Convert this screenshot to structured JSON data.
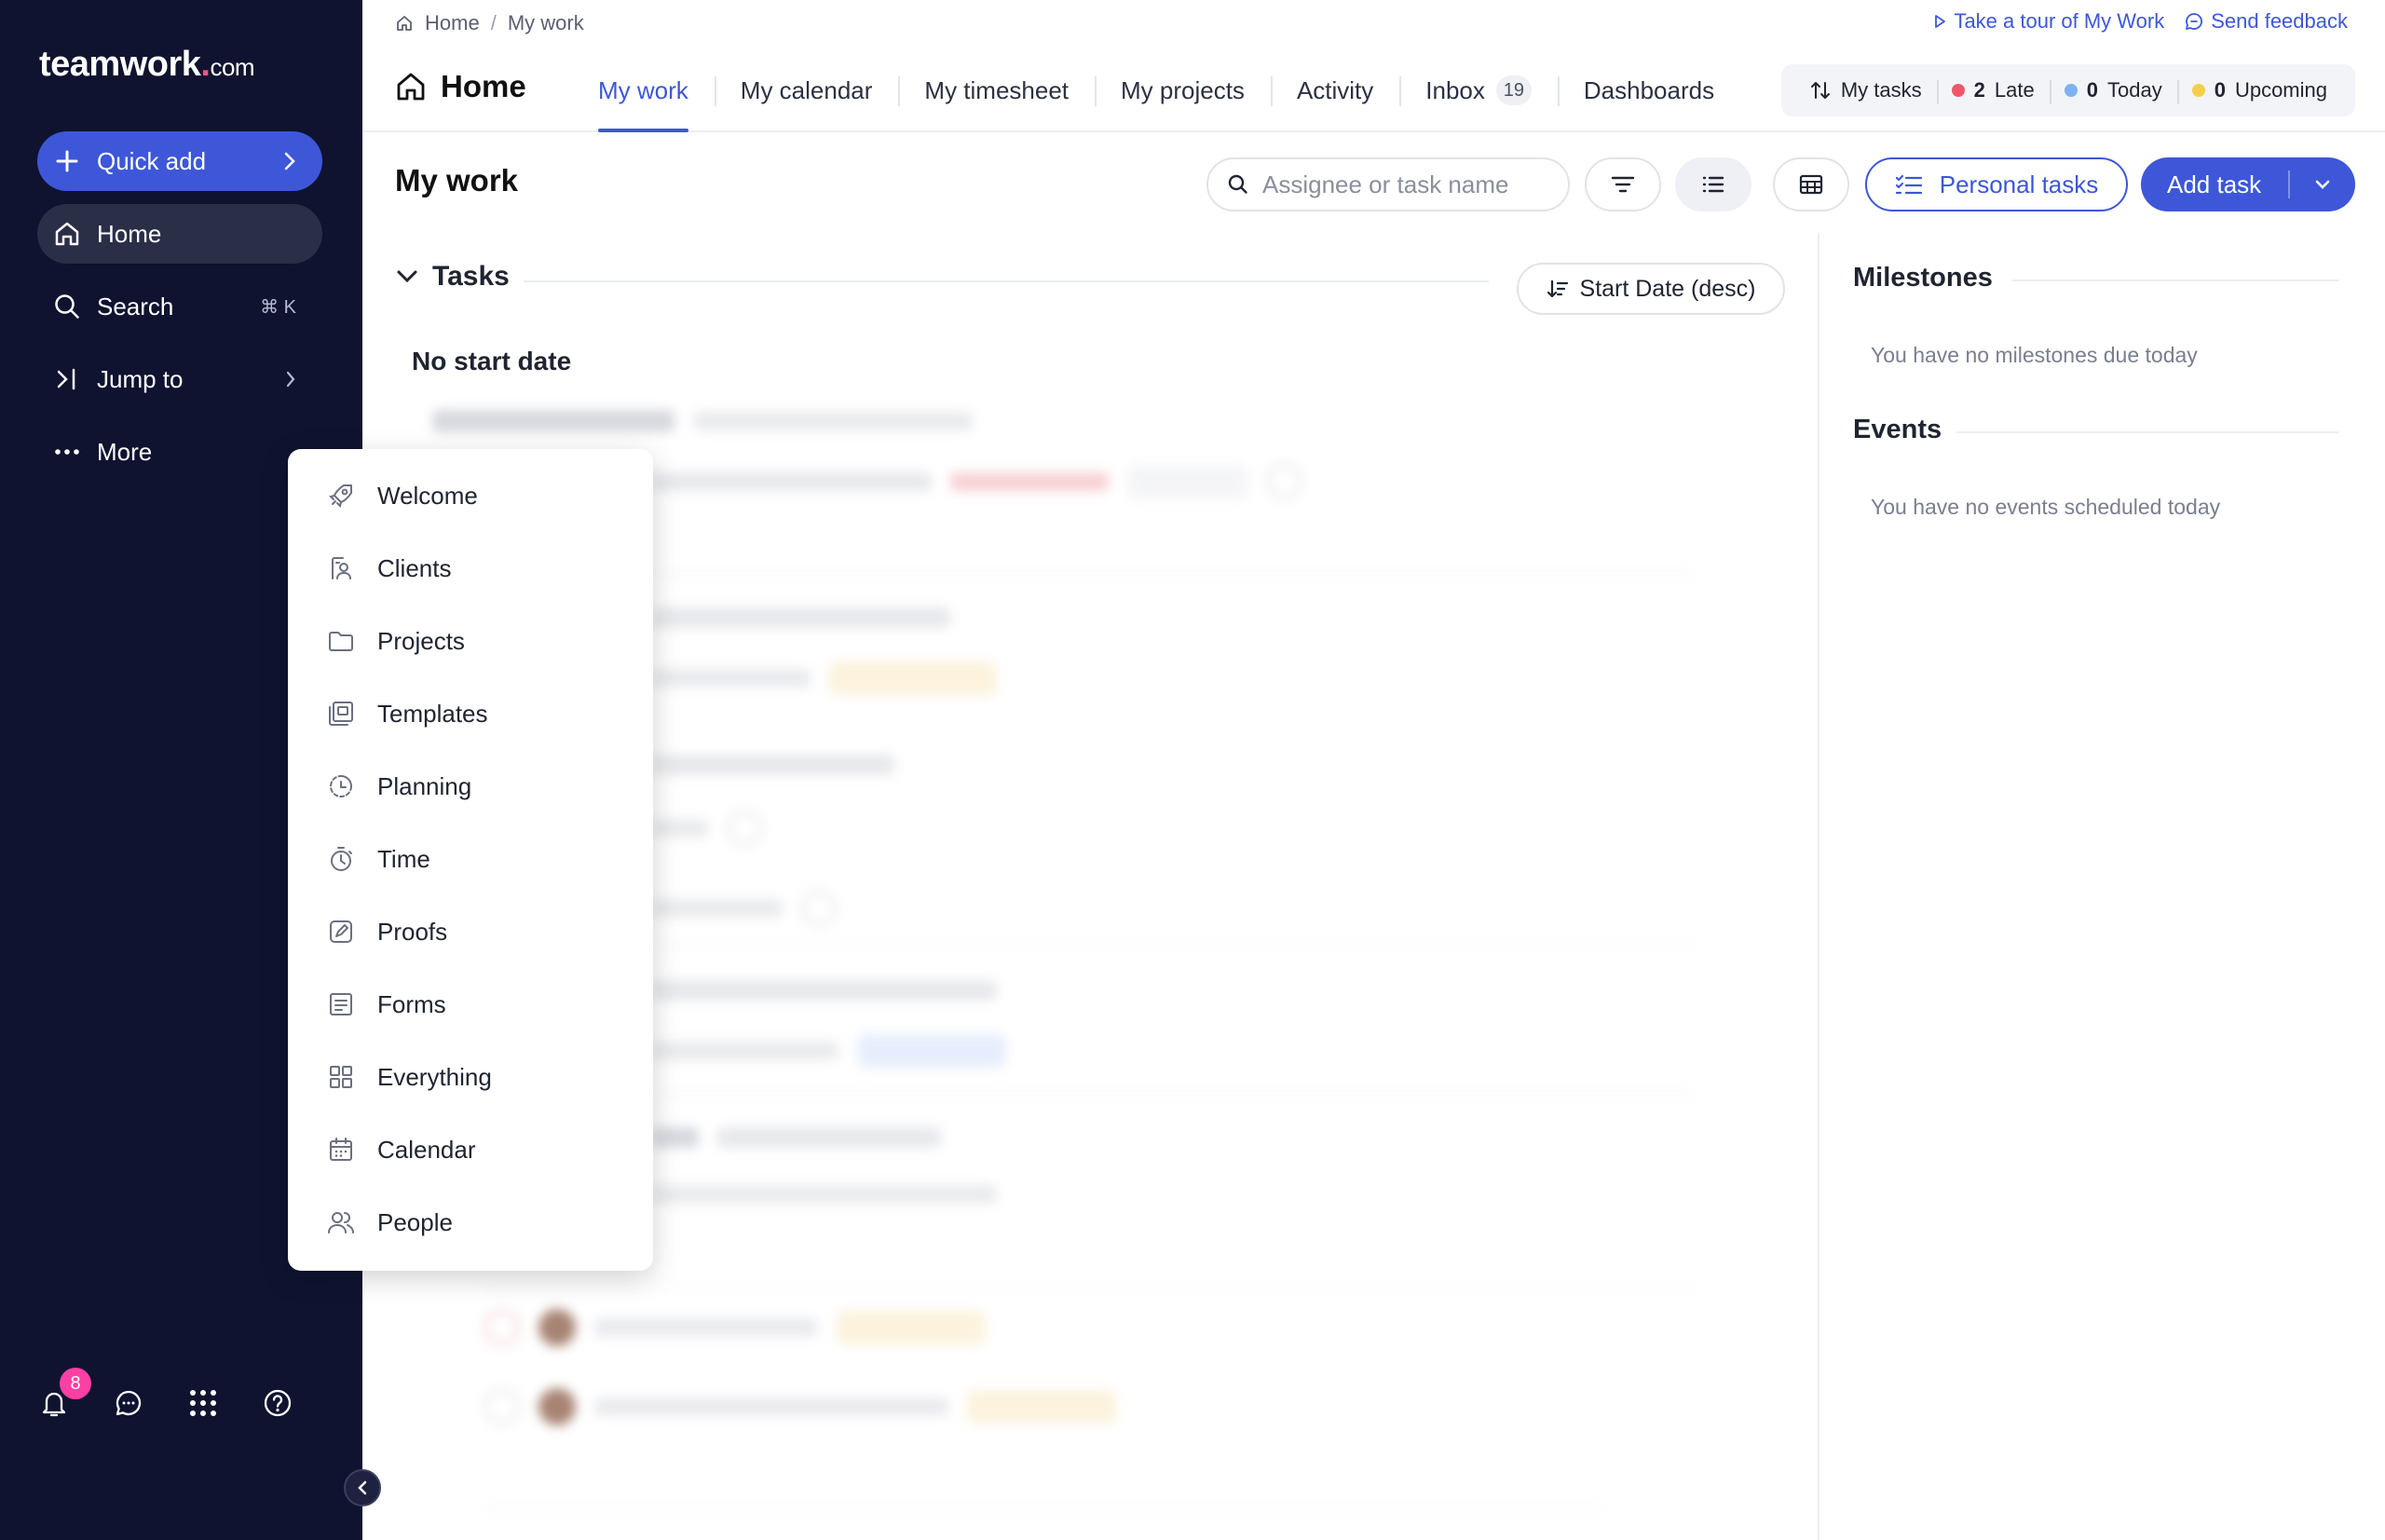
{
  "brand": {
    "logo_text": "teamwork",
    "logo_dot": ".",
    "logo_suffix": "com",
    "accent": "#3d57d8",
    "sidebar_bg": "#0f1330"
  },
  "sidebar": {
    "quick_add": "Quick add",
    "home": "Home",
    "search": "Search",
    "search_shortcut": "⌘ K",
    "jump_to": "Jump to",
    "more": "More",
    "notifications_count": "8"
  },
  "more_menu": {
    "items": [
      {
        "label": "Welcome",
        "icon": "rocket-icon"
      },
      {
        "label": "Clients",
        "icon": "clients-icon"
      },
      {
        "label": "Projects",
        "icon": "folder-icon"
      },
      {
        "label": "Templates",
        "icon": "templates-icon"
      },
      {
        "label": "Planning",
        "icon": "planning-icon"
      },
      {
        "label": "Time",
        "icon": "stopwatch-icon"
      },
      {
        "label": "Proofs",
        "icon": "proofs-icon"
      },
      {
        "label": "Forms",
        "icon": "forms-icon"
      },
      {
        "label": "Everything",
        "icon": "grid-icon"
      },
      {
        "label": "Calendar",
        "icon": "calendar-icon"
      },
      {
        "label": "People",
        "icon": "people-icon"
      }
    ]
  },
  "breadcrumb": {
    "home": "Home",
    "separator": "/",
    "current": "My work"
  },
  "top_links": {
    "tour": "Take a tour of My Work",
    "feedback": "Send feedback"
  },
  "nav": {
    "title": "Home",
    "tabs": [
      {
        "label": "My work",
        "active": true
      },
      {
        "label": "My calendar"
      },
      {
        "label": "My timesheet"
      },
      {
        "label": "My projects"
      },
      {
        "label": "Activity"
      },
      {
        "label": "Inbox",
        "count": "19"
      },
      {
        "label": "Dashboards"
      }
    ]
  },
  "summary": {
    "my_tasks": "My tasks",
    "late_count": "2",
    "late_label": "Late",
    "late_color": "#f0566a",
    "today_count": "0",
    "today_label": "Today",
    "today_color": "#7fb3f0",
    "upcoming_count": "0",
    "upcoming_label": "Upcoming",
    "upcoming_color": "#f5cf4b"
  },
  "toolbar": {
    "page_title": "My work",
    "search_placeholder": "Assignee or task name",
    "personal_tasks": "Personal tasks",
    "add_task": "Add task"
  },
  "tasks": {
    "section_title": "Tasks",
    "sort_label": "Start Date (desc)",
    "group_label": "No start date"
  },
  "right_panel": {
    "milestones_title": "Milestones",
    "milestones_empty": "You have no milestones due today",
    "events_title": "Events",
    "events_empty": "You have no events scheduled today"
  }
}
